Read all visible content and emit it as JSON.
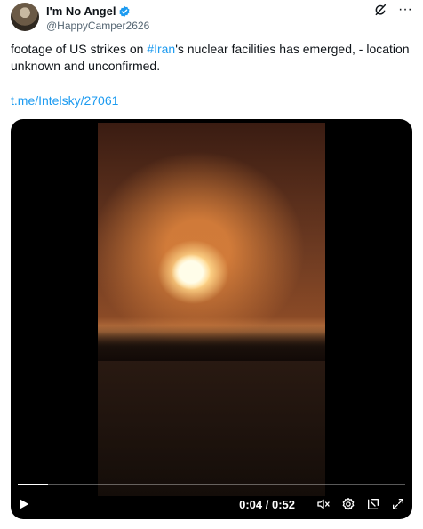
{
  "author": {
    "display_name": "I'm No Angel",
    "handle": "@HappyCamper2626"
  },
  "tweet": {
    "text_before": "footage of US strikes on ",
    "hashtag": "#Iran",
    "text_after": "'s nuclear facilities has emerged, - location unknown and unconfirmed.",
    "link": "t.me/Intelsky/27061"
  },
  "video": {
    "time_display": "0:04 / 0:52",
    "progress_fraction": 0.077
  },
  "colors": {
    "accent": "#1d9bf0",
    "text": "#0f1419",
    "secondary": "#536471"
  },
  "icons": [
    "verified-badge-icon",
    "grok-icon",
    "more-icon",
    "play-icon",
    "mute-icon",
    "settings-icon",
    "picture-in-picture-icon",
    "fullscreen-icon"
  ]
}
